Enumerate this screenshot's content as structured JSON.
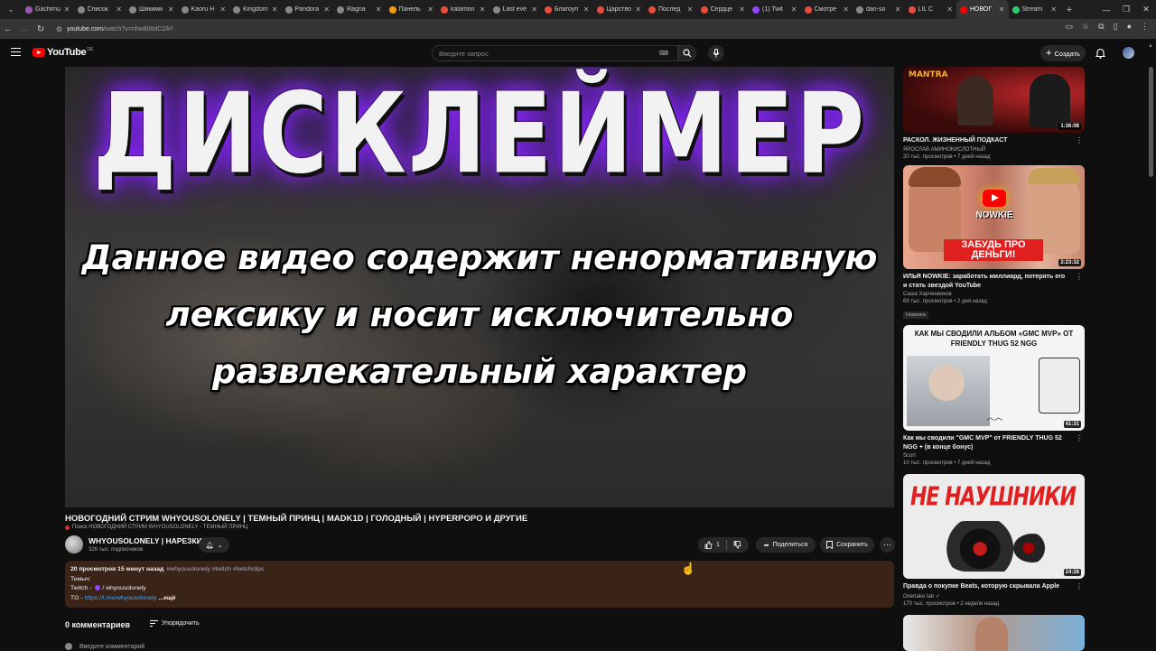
{
  "tabs": [
    {
      "title": "Gachimu",
      "color": "#9b59b6"
    },
    {
      "title": "Список",
      "color": "#888888"
    },
    {
      "title": "Шикими",
      "color": "#888888"
    },
    {
      "title": "Kaoru H",
      "color": "#888888"
    },
    {
      "title": "Kingdom",
      "color": "#888888"
    },
    {
      "title": "Pandora",
      "color": "#888888"
    },
    {
      "title": "Ragna",
      "color": "#888888"
    },
    {
      "title": "Панель",
      "color": "#f39c12"
    },
    {
      "title": "kalamon",
      "color": "#e74c3c"
    },
    {
      "title": "Last eve",
      "color": "#888888"
    },
    {
      "title": "Благоуп",
      "color": "#e74c3c"
    },
    {
      "title": "Царство",
      "color": "#e74c3c"
    },
    {
      "title": "Послед",
      "color": "#e74c3c"
    },
    {
      "title": "Сердце",
      "color": "#e74c3c"
    },
    {
      "title": "(1) Twit",
      "color": "#9146ff"
    },
    {
      "title": "Смотре",
      "color": "#e74c3c"
    },
    {
      "title": "dan-so",
      "color": "#888888"
    },
    {
      "title": "LIL C",
      "color": "#e74c3c"
    },
    {
      "title": "НОВОГ",
      "color": "#ff0000"
    },
    {
      "title": "Stream",
      "color": "#2ecc71"
    }
  ],
  "address": {
    "host": "youtube.com",
    "path": "/watch?v=nhw808dC2AY"
  },
  "header": {
    "logo_text": "YouTube",
    "region": "DE",
    "search_placeholder": "Введите запрос",
    "create_label": "Создать"
  },
  "player": {
    "title_overlay": "ДИСКЛЕЙМЕР",
    "lines": [
      "Данное видео содержит ненормативную",
      "лексику и носит исключительно",
      "развлекательный характер"
    ]
  },
  "video": {
    "title": "НОВОГОДНИЙ СТРИМ WHYOUSOLONELY | ТЕМНЫЙ ПРИНЦ | MADK1D | ГОЛОДНЫЙ | HYPERPOPO И ДРУГИЕ",
    "subline": "Поиск НОВОГОДНИЙ СТРИМ WHYOUSOLONELY - ТЕМНЫЙ ПРИНЦ",
    "channel": "WHYOUSOLONELY | НАРЕЗКИ",
    "subscribers": "326 тыс. подписчиков",
    "likes": "1",
    "share_label": "Поделиться",
    "save_label": "Сохранить"
  },
  "description": {
    "stats": "20 просмотров  15 минут назад",
    "tags": "#whyousolonely #twitch #twitchclips",
    "line2": "Темыч:",
    "line3_prefix": "Twitch - ",
    "line3_link": "/ whyousolonely",
    "line4_prefix": "TG - ",
    "line4_link": "https://t.me/whyousolonely",
    "more": "...ещё"
  },
  "comments": {
    "count_label": "0 комментариев",
    "sort_label": "Упорядочить",
    "add_placeholder": "Введите комментарий"
  },
  "recommendations": [
    {
      "title": "РАСКОЛ. ЖИЗНЕННЫЙ ПОДКАСТ",
      "channel": "ЯРОСЛАВ АМИНОКИСЛОТНЫЙ",
      "meta": "20 тыс. просмотров • 7 дней назад",
      "duration": "1:36:08",
      "thumb_text": "MANTRA"
    },
    {
      "title": "ИЛЬЯ NOWKIE: заработать миллиард, потерять его и стать звездой YouTube",
      "channel": "Саша Харченвиков",
      "meta": "69 тыс. просмотров • 2 дня назад",
      "duration": "2:23:32",
      "badge": "Новинка",
      "thumb_text": "NOWKIE",
      "thumb_caption": "ЗАБУДЬ ПРО ДЕНЬГИ!"
    },
    {
      "title": "Как мы сводили \"GMC MVP\" от FRIENDLY THUG 52 NGG + (в конце бонус)",
      "channel": "Scorl",
      "meta": "10 тыс. просмотров • 7 дней назад",
      "duration": "41:31",
      "thumb_text": "КАК МЫ СВОДИЛИ АЛЬБОМ «GMC MVP» ОТ FRIENDLY THUG 52 NGG"
    },
    {
      "title": "Правда о покупке Beats, которую скрывала Apple",
      "channel": "Overtake lab",
      "meta": "170 тыс. просмотров • 2 недели назад",
      "duration": "24:28",
      "thumb_text": "НЕ НАУШНИКИ"
    }
  ]
}
